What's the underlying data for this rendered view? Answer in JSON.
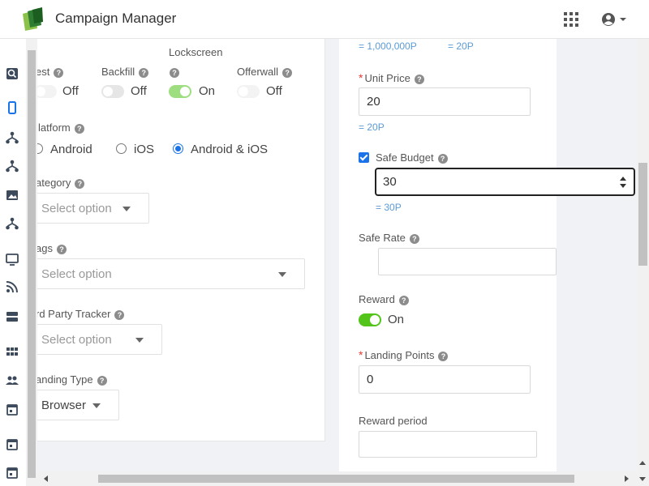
{
  "header": {
    "title": "Campaign Manager",
    "apps_icon": "apps-grid-icon",
    "user_icon": "account-circle-icon"
  },
  "sidebar": {
    "icons": [
      "search-box-icon",
      "mobile-icon",
      "hierarchy-icon",
      "hierarchy-icon",
      "image-icon",
      "hierarchy-icon",
      "monitor-icon",
      "rss-icon",
      "server-icon",
      "grid-icon",
      "people-icon",
      "calendar-icon",
      "calendar-icon",
      "calendar-icon"
    ]
  },
  "colors": {
    "accent": "#1a73e8",
    "toggle_on": "#52c41a",
    "hint": "#5b9bd5",
    "required": "#e53935"
  },
  "left": {
    "toggles": [
      {
        "label": "est",
        "state": "Off"
      },
      {
        "label": "Backfill",
        "state": "Off"
      },
      {
        "label": "Lockscreen",
        "state": "On"
      },
      {
        "label": "Offerwall",
        "state": "Off"
      }
    ],
    "platform": {
      "label": "latform",
      "options": [
        "Android",
        "iOS",
        "Android & iOS"
      ],
      "selected": "Android & iOS"
    },
    "category": {
      "label": "ategory",
      "placeholder": "Select option"
    },
    "tags": {
      "label": "ags",
      "placeholder": "Select option"
    },
    "tracker": {
      "label": "rd Party Tracker",
      "placeholder": "Select option"
    },
    "landing_type": {
      "label": "anding Type",
      "value": "Browser"
    }
  },
  "right": {
    "top_hints": [
      "= 1,000,000P",
      "= 20P"
    ],
    "unit_price": {
      "label": "Unit Price",
      "value": "20",
      "hint": "= 20P"
    },
    "safe_budget": {
      "label": "Safe Budget",
      "value": "30",
      "hint": "= 30P"
    },
    "safe_rate": {
      "label": "Safe Rate",
      "value": ""
    },
    "reward": {
      "label": "Reward",
      "state": "On"
    },
    "landing_points": {
      "label": "Landing Points",
      "value": "0"
    },
    "reward_period": {
      "label": "Reward period",
      "value": ""
    }
  }
}
